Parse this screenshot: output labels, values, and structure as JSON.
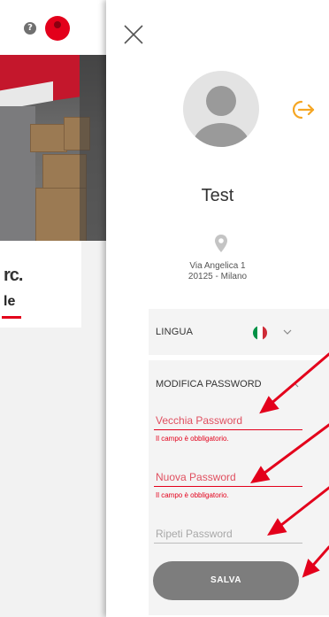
{
  "header": {
    "help_icon_glyph": "?"
  },
  "background_card": {
    "logo_text": "rc.",
    "subtitle_text": "le"
  },
  "profile": {
    "name": "Test",
    "address_line1": "Via Angelica 1",
    "address_line2": "20125 - Milano"
  },
  "language": {
    "label": "LINGUA",
    "flag_colors": [
      "#009246",
      "#ffffff",
      "#ce2b37"
    ]
  },
  "password": {
    "section_title": "MODIFICA PASSWORD",
    "old_placeholder": "Vecchia Password",
    "old_error": "Il campo è obbligatorio.",
    "new_placeholder": "Nuova Password",
    "new_error": "Il campo è obbligatorio.",
    "repeat_placeholder": "Ripeti Password",
    "save_label": "SALVA"
  },
  "colors": {
    "accent_red": "#e3001b",
    "logout_icon": "#f5a623",
    "save_button": "#7d7d7d",
    "panel_bg": "#f4f4f4"
  },
  "icons": [
    "help-icon",
    "brand-icon",
    "close-icon",
    "logout-icon",
    "avatar-icon",
    "location-pin-icon",
    "italy-flag-icon",
    "chevron-down-icon",
    "chevron-up-icon"
  ]
}
